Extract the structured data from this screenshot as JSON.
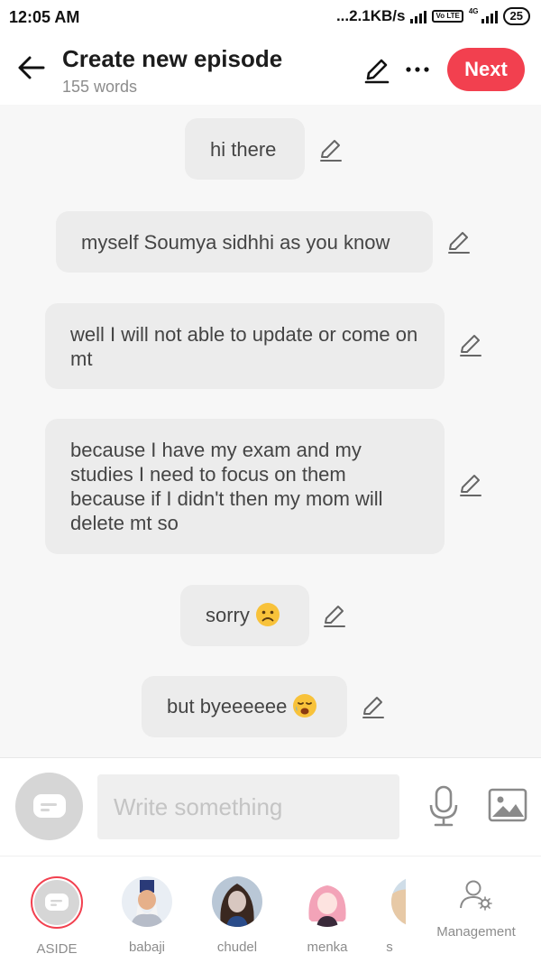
{
  "status_bar": {
    "time": "12:05 AM",
    "network_speed": "...2.1KB/s",
    "volte": "Vo LTE",
    "net_type": "4G",
    "battery": "25"
  },
  "header": {
    "title": "Create new episode",
    "subtitle": "155 words",
    "next_label": "Next"
  },
  "messages": [
    {
      "text": "hi there"
    },
    {
      "text": "myself Soumya sidhhi as you know"
    },
    {
      "text": "well I will not able to update or come on mt"
    },
    {
      "text": "because I have my exam and my studies I need to focus on them because if I didn't then my mom will delete mt so"
    },
    {
      "text": "sorry",
      "emoji": "sad-face-emoji"
    },
    {
      "text": "but byeeeeee",
      "emoji": "crying-face-emoji"
    }
  ],
  "composer": {
    "placeholder": "Write something"
  },
  "characters": [
    {
      "label": "ASIDE",
      "selected": true
    },
    {
      "label": "babaji"
    },
    {
      "label": "chudel"
    },
    {
      "label": "menka"
    },
    {
      "label": "s"
    }
  ],
  "management": {
    "label": "Management"
  },
  "colors": {
    "accent": "#f2404f",
    "bubble": "#ececec",
    "chat_bg": "#f7f7f7",
    "muted_text": "#8c8c8c"
  }
}
